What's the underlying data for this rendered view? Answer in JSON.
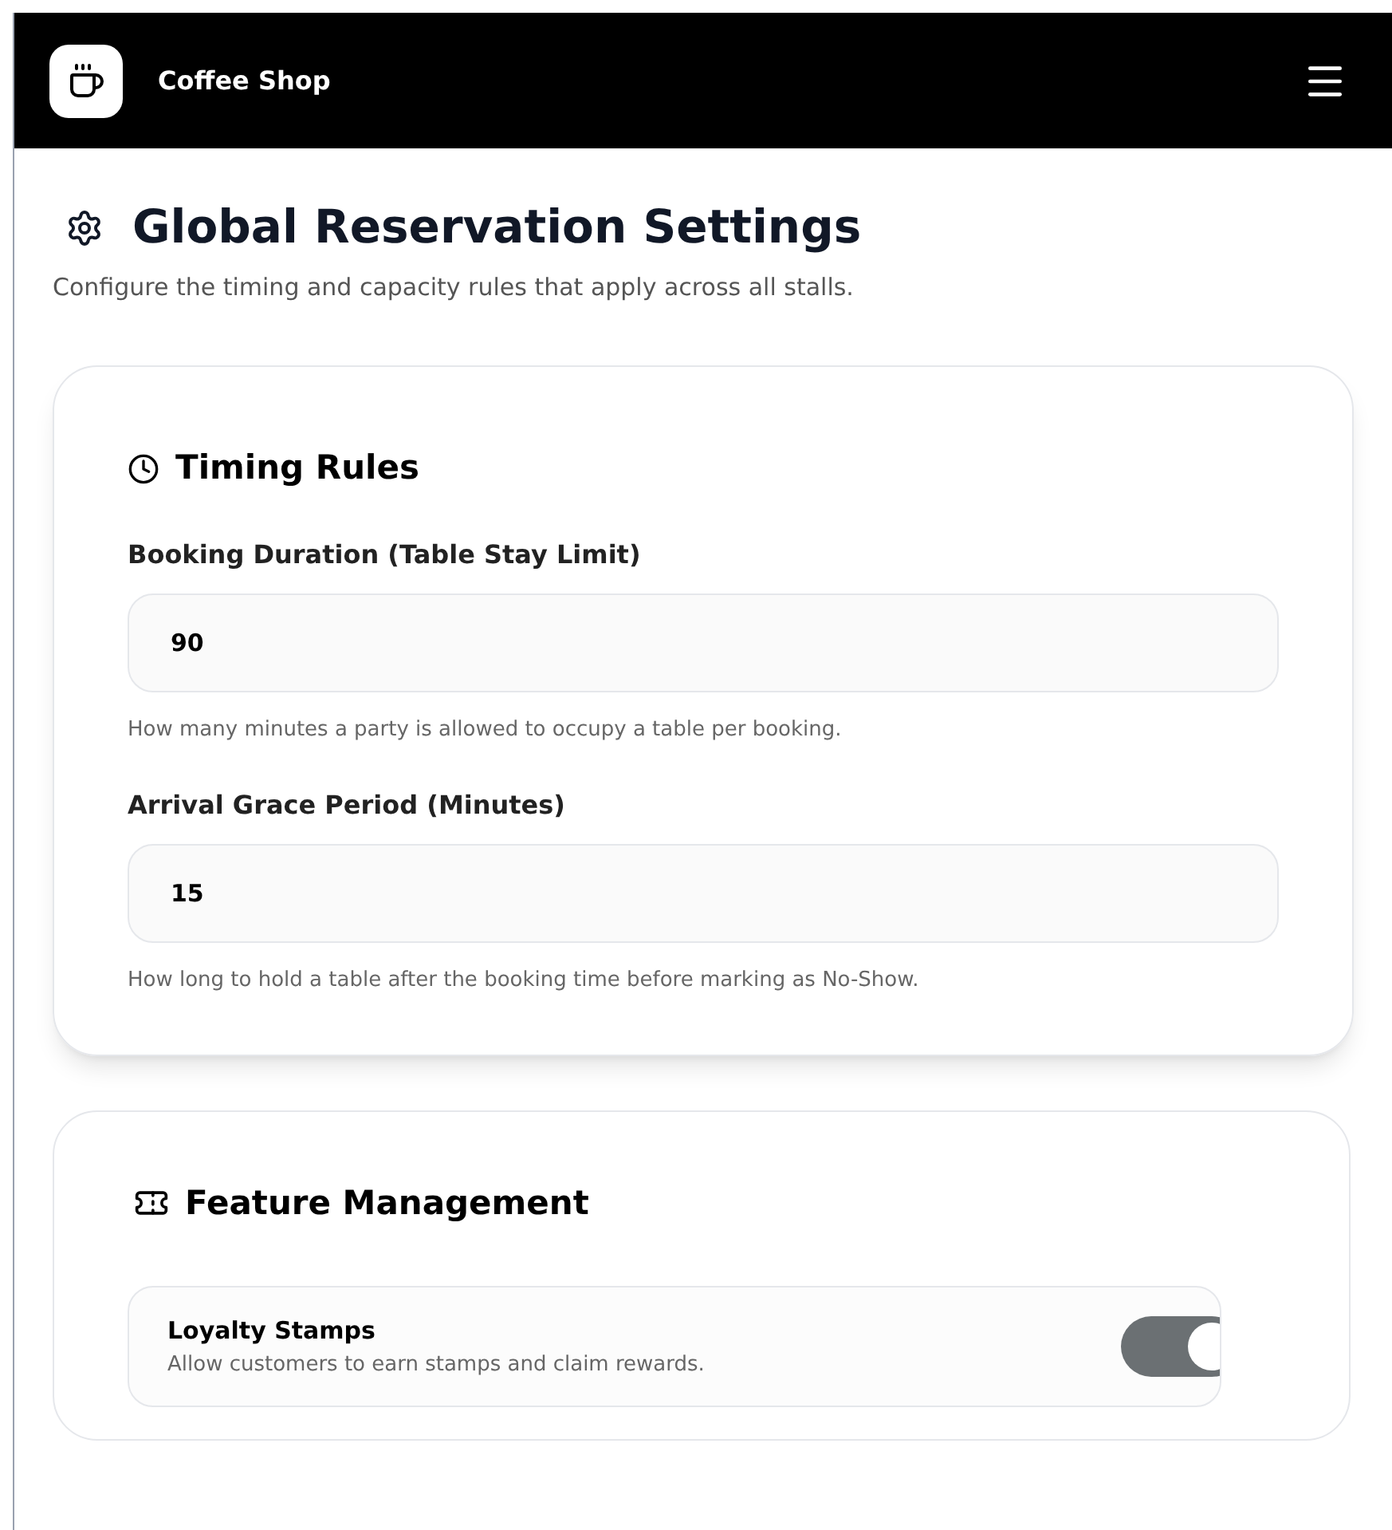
{
  "app_bar": {
    "title": "Coffee Shop"
  },
  "page": {
    "title": "Global Reservation Settings",
    "subtitle": "Configure the timing and capacity rules that apply across all stalls."
  },
  "timing_rules": {
    "title": "Timing Rules",
    "fields": [
      {
        "label": "Booking Duration (Table Stay Limit)",
        "value": "90",
        "help": "How many minutes a party is allowed to occupy a table per booking."
      },
      {
        "label": "Arrival Grace Period (Minutes)",
        "value": "15",
        "help": "How long to hold a table after the booking time before marking as No-Show."
      }
    ]
  },
  "feature_management": {
    "title": "Feature Management",
    "features": [
      {
        "name": "Loyalty Stamps",
        "description": "Allow customers to earn stamps and claim rewards.",
        "on": true
      }
    ]
  }
}
